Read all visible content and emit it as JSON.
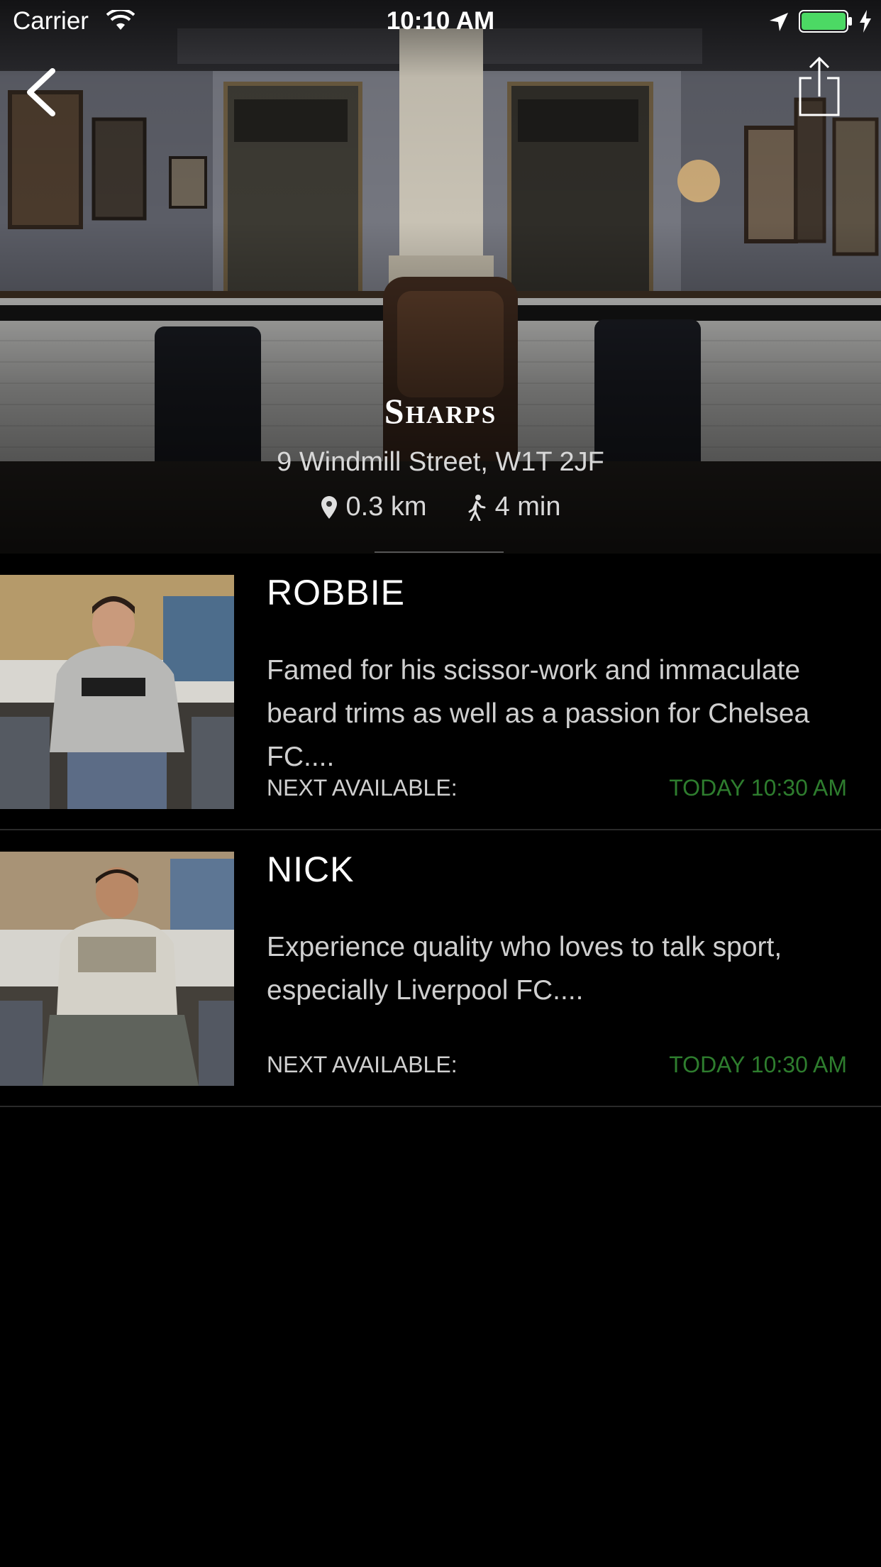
{
  "status_bar": {
    "carrier": "Carrier",
    "time": "10:10 AM",
    "battery_color": "#4cd964"
  },
  "nav": {
    "back_icon": "chevron-left-icon",
    "share_icon": "share-icon"
  },
  "shop": {
    "name": "Sharps",
    "address": "9 Windmill Street, W1T 2JF",
    "distance": "0.3 km",
    "walk_time": "4 min"
  },
  "barbers": [
    {
      "name": "ROBBIE",
      "description": "Famed for his scissor-work and immaculate beard trims as well as a passion for Chelsea FC....",
      "next_label": "NEXT AVAILABLE:",
      "next_time": "TODAY 10:30 AM"
    },
    {
      "name": "NICK",
      "description": "Experience quality who loves to talk sport, especially Liverpool FC....",
      "next_label": "NEXT AVAILABLE:",
      "next_time": "TODAY 10:30 AM"
    }
  ],
  "colors": {
    "accent_green": "#2e7d2e",
    "background": "#000000"
  }
}
